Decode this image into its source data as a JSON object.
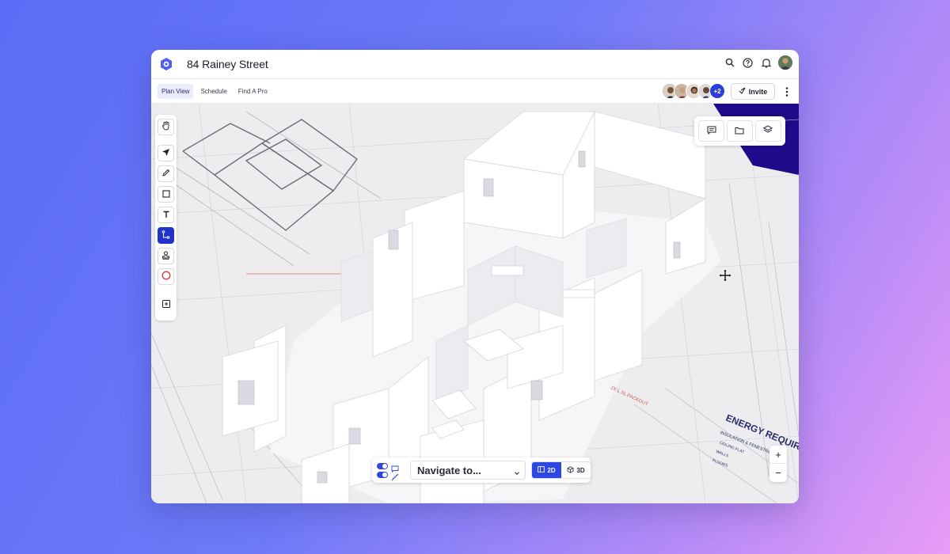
{
  "app": {
    "project_title": "84 Rainey Street"
  },
  "tabs": [
    {
      "label": "Plan View",
      "active": true
    },
    {
      "label": "Schedule",
      "active": false
    },
    {
      "label": "Find A Pro",
      "active": false
    }
  ],
  "collaborators": {
    "more_count": "+2"
  },
  "invite": {
    "label": "Invite"
  },
  "navigator": {
    "placeholder": "Navigate to...",
    "view_2d": "2D",
    "view_3d": "3D",
    "active_view": "2D"
  },
  "plan_text": {
    "energy_title": "ENERGY REQUIR",
    "insulation": "INSULATION & FENESTRATION",
    "ceiling": "CEILING FLAT",
    "walls": "WALLS",
    "floors": "FLOORS",
    "packout": "2X L.SL PACKOUT"
  },
  "colors": {
    "accent": "#2233c9",
    "toggle": "#2f47e0",
    "floor_dark": "#1f0a8a"
  },
  "icons": [
    "logo-icon",
    "search-icon",
    "help-icon",
    "bell-icon",
    "hand-icon",
    "pointer-icon",
    "pencil-icon",
    "rectangle-icon",
    "text-icon",
    "path-icon",
    "stamp-icon",
    "circle-icon",
    "add-note-icon",
    "comment-icon",
    "folder-icon",
    "layers-icon",
    "move-icon"
  ]
}
